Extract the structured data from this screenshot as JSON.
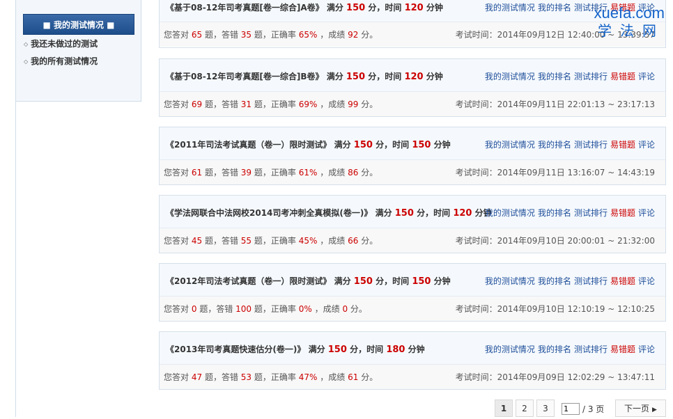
{
  "sidebar": {
    "header": "■ 我的测试情况 ■",
    "links": [
      "我还未做过的测试",
      "我的所有测试情况"
    ]
  },
  "watermark": {
    "line1": "xuefa.com",
    "line2": "学法网"
  },
  "labels": {
    "full_score": "满分",
    "points": "分",
    "time_limit": "，时间",
    "minutes": "分钟",
    "answered_right": "您答对",
    "questions_wrong": "题，答错",
    "questions_accuracy": "题，正确率",
    "score": "，成绩",
    "score_unit": "分。",
    "exam_time": "考试时间："
  },
  "card_links": [
    "我的测试情况",
    "我的排名",
    "测试排行",
    "易错题",
    "评论"
  ],
  "tests": [
    {
      "title": "《基于08-12年司考真题[卷一综合]A卷》",
      "full": "150",
      "minutes": "120",
      "right": "65",
      "wrong": "35",
      "accuracy": "65%",
      "score": "92",
      "time": "2014年09月12日 12:40:00 ~ 13:39:57"
    },
    {
      "title": "《基于08-12年司考真题[卷一综合]B卷》",
      "full": "150",
      "minutes": "120",
      "right": "69",
      "wrong": "31",
      "accuracy": "69%",
      "score": "99",
      "time": "2014年09月11日 22:01:13 ~ 23:17:13"
    },
    {
      "title": "《2011年司法考试真题（卷一）限时测试》",
      "full": "150",
      "minutes": "150",
      "right": "61",
      "wrong": "39",
      "accuracy": "61%",
      "score": "86",
      "time": "2014年09月11日 13:16:07 ~ 14:43:19"
    },
    {
      "title": "《学法网联合中法网校2014司考冲刺全真模拟(卷一)》",
      "full": "150",
      "minutes": "120",
      "right": "45",
      "wrong": "55",
      "accuracy": "45%",
      "score": "66",
      "time": "2014年09月10日 20:00:01 ~ 21:32:00"
    },
    {
      "title": "《2012年司法考试真题（卷一）限时测试》",
      "full": "150",
      "minutes": "150",
      "right": "0",
      "wrong": "100",
      "accuracy": "0%",
      "score": "0",
      "time": "2014年09月10日 12:10:19 ~ 12:10:25"
    },
    {
      "title": "《2013年司考真题快速估分(卷一)》",
      "full": "150",
      "minutes": "180",
      "right": "47",
      "wrong": "53",
      "accuracy": "47%",
      "score": "61",
      "time": "2014年09月09日 12:02:29 ~ 13:47:11"
    }
  ],
  "pagination": {
    "pages": [
      "1",
      "2",
      "3"
    ],
    "current": "1",
    "input_value": "1",
    "total": "/ 3 页",
    "next": "下一页"
  }
}
